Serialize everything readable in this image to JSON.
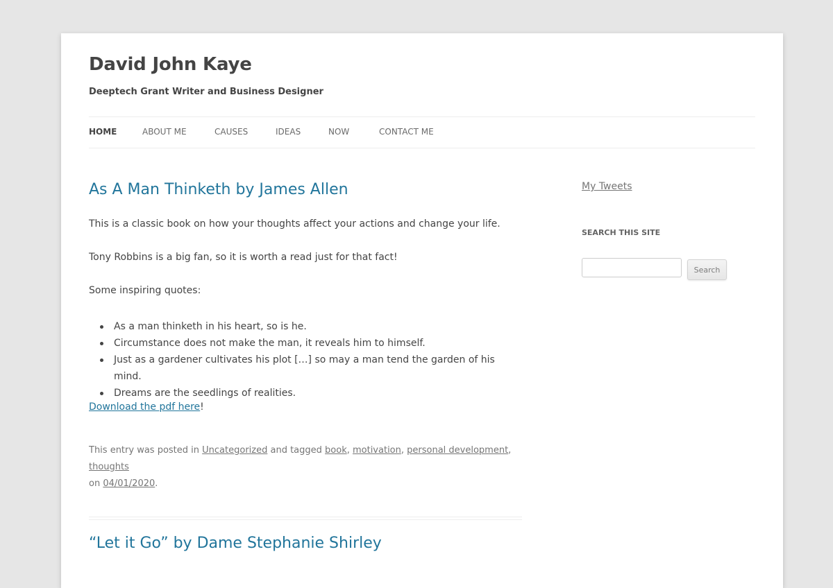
{
  "site": {
    "title": "David John Kaye",
    "description": "Deeptech Grant Writer and Business Designer"
  },
  "nav": {
    "items": [
      {
        "label": "HOME",
        "current": true
      },
      {
        "label": "ABOUT ME"
      },
      {
        "label": "CAUSES"
      },
      {
        "label": "IDEAS"
      },
      {
        "label": "NOW"
      },
      {
        "label": "CONTACT ME"
      }
    ]
  },
  "post1": {
    "title": "As A Man Thinketh by James Allen",
    "paragraphs": [
      "This is a classic book on how your thoughts affect your actions and change your life.",
      "Tony Robbins is a big fan, so it is worth a read just for that fact!",
      "Some inspiring quotes:"
    ],
    "quotes": [
      "As a man thinketh in his heart, so is he.",
      "Circumstance does not make the man, it reveals him to himself.",
      "Just as a gardener cultivates his plot […] so may a man tend the garden of his mind.",
      "Dreams are the seedlings of realities."
    ],
    "download_link": "Download the pdf here",
    "download_suffix": "!",
    "meta": {
      "prefix": "This entry was posted in ",
      "category": "Uncategorized",
      "tagged_text": " and tagged ",
      "tags": [
        "book",
        "motivation",
        "personal development",
        "thoughts"
      ],
      "comma": ", ",
      "on_text": "on ",
      "date": "04/01/2020",
      "end": "."
    }
  },
  "post2": {
    "title": "“Let it Go” by Dame Stephanie Shirley"
  },
  "sidebar": {
    "tweets_link": "My Tweets",
    "search_widget_title": "SEARCH THIS SITE",
    "search_button": "Search",
    "search_value": ""
  },
  "colors": {
    "link": "#21759b",
    "background": "#e6e6e6",
    "page": "#ffffff",
    "text": "#444444",
    "meta": "#757575"
  }
}
